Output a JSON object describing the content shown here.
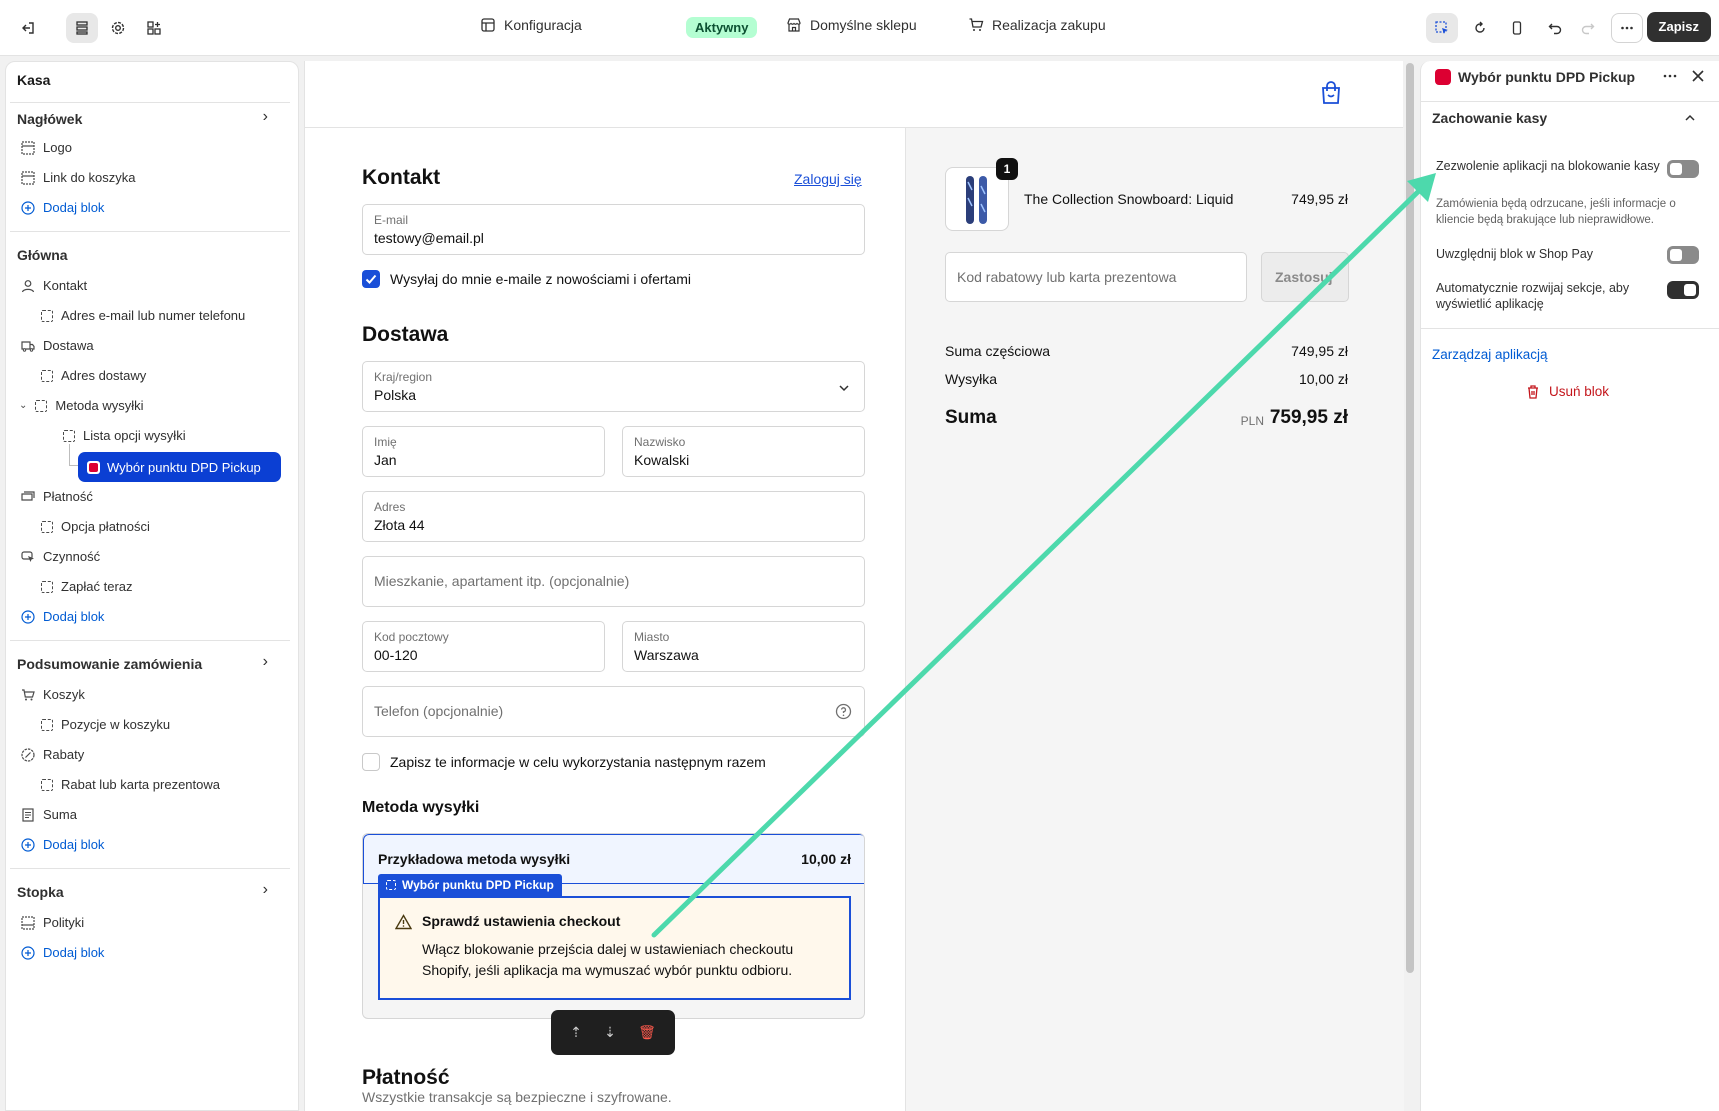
{
  "topbar": {
    "nav_konfiguracja": "Konfiguracja",
    "status_badge": "Aktywny",
    "nav_domyslne": "Domyślne sklepu",
    "nav_realizacja": "Realizacja zakupu",
    "save_label": "Zapisz"
  },
  "sidebar": {
    "title": "Kasa",
    "naglowek": "Nagłówek",
    "logo": "Logo",
    "link_koszyk": "Link do koszyka",
    "add_block": "Dodaj blok",
    "glowna": "Główna",
    "kontakt": "Kontakt",
    "adres_email": "Adres e-mail lub numer telefonu",
    "dostawa": "Dostawa",
    "adres_dostawy": "Adres dostawy",
    "metoda_wysylki": "Metoda wysyłki",
    "lista_opcji": "Lista opcji wysyłki",
    "wybor_dpd": "Wybór punktu DPD Pickup",
    "platnosc": "Płatność",
    "opcja_platnosci": "Opcja płatności",
    "czynnosc": "Czynność",
    "zaplac_teraz": "Zapłać teraz",
    "podsumowanie": "Podsumowanie zamówienia",
    "koszyk": "Koszyk",
    "pozycje": "Pozycje w koszyku",
    "rabaty": "Rabaty",
    "rabat_karta": "Rabat lub karta prezentowa",
    "suma": "Suma",
    "stopka": "Stopka",
    "polityki": "Polityki"
  },
  "checkout": {
    "kontakt_title": "Kontakt",
    "login_link": "Zaloguj się",
    "email_label": "E-mail",
    "email_value": "testowy@email.pl",
    "newsletter": "Wysyłaj do mnie e-maile z nowościami i ofertami",
    "dostawa_title": "Dostawa",
    "country_label": "Kraj/region",
    "country_value": "Polska",
    "first_label": "Imię",
    "first_value": "Jan",
    "last_label": "Nazwisko",
    "last_value": "Kowalski",
    "address_label": "Adres",
    "address_value": "Złota 44",
    "apt_placeholder": "Mieszkanie, apartament itp. (opcjonalnie)",
    "zip_label": "Kod pocztowy",
    "zip_value": "00-120",
    "city_label": "Miasto",
    "city_value": "Warszawa",
    "phone_placeholder": "Telefon (opcjonalnie)",
    "save_info": "Zapisz te informacje w celu wykorzystania następnym razem",
    "shipping_title": "Metoda wysyłki",
    "shipping_option": "Przykładowa metoda wysyłki",
    "shipping_price": "10,00 zł",
    "dpd_tag": "Wybór punktu DPD Pickup",
    "warn_title": "Sprawdź ustawienia checkout",
    "warn_line1": "Włącz blokowanie przejścia dalej w ustawieniach checkoutu",
    "warn_line2": "Shopify, jeśli aplikacja ma wymuszać wybór punktu odbioru.",
    "payment_title": "Płatność",
    "payment_sub": "Wszystkie transakcje są bezpieczne i szyfrowane."
  },
  "summary": {
    "qty": "1",
    "product": "The Collection Snowboard: Liquid",
    "product_price": "749,95 zł",
    "discount_placeholder": "Kod rabatowy lub karta prezentowa",
    "apply": "Zastosuj",
    "subtotal_label": "Suma częściowa",
    "subtotal_value": "749,95 zł",
    "shipping_label": "Wysyłka",
    "shipping_value": "10,00 zł",
    "total_label": "Suma",
    "currency": "PLN",
    "total_value": "759,95 zł"
  },
  "right_panel": {
    "title": "Wybór punktu DPD Pickup",
    "section": "Zachowanie kasy",
    "opt1": "Zezwolenie aplikacji na blokowanie kasy",
    "opt1_help": "Zamówienia będą odrzucane, jeśli informacje o kliencie będą brakujące lub nieprawidłowe.",
    "opt2": "Uwzględnij blok w Shop Pay",
    "opt3": "Automatycznie rozwijaj sekcje, aby wyświetlić aplikację",
    "manage": "Zarządzaj aplikacją",
    "remove": "Usuń blok"
  },
  "colors": {
    "accent": "#1a4fd8",
    "arrow": "#4dd9ac",
    "status_green": "#b4fed2",
    "danger": "#c4161c"
  }
}
